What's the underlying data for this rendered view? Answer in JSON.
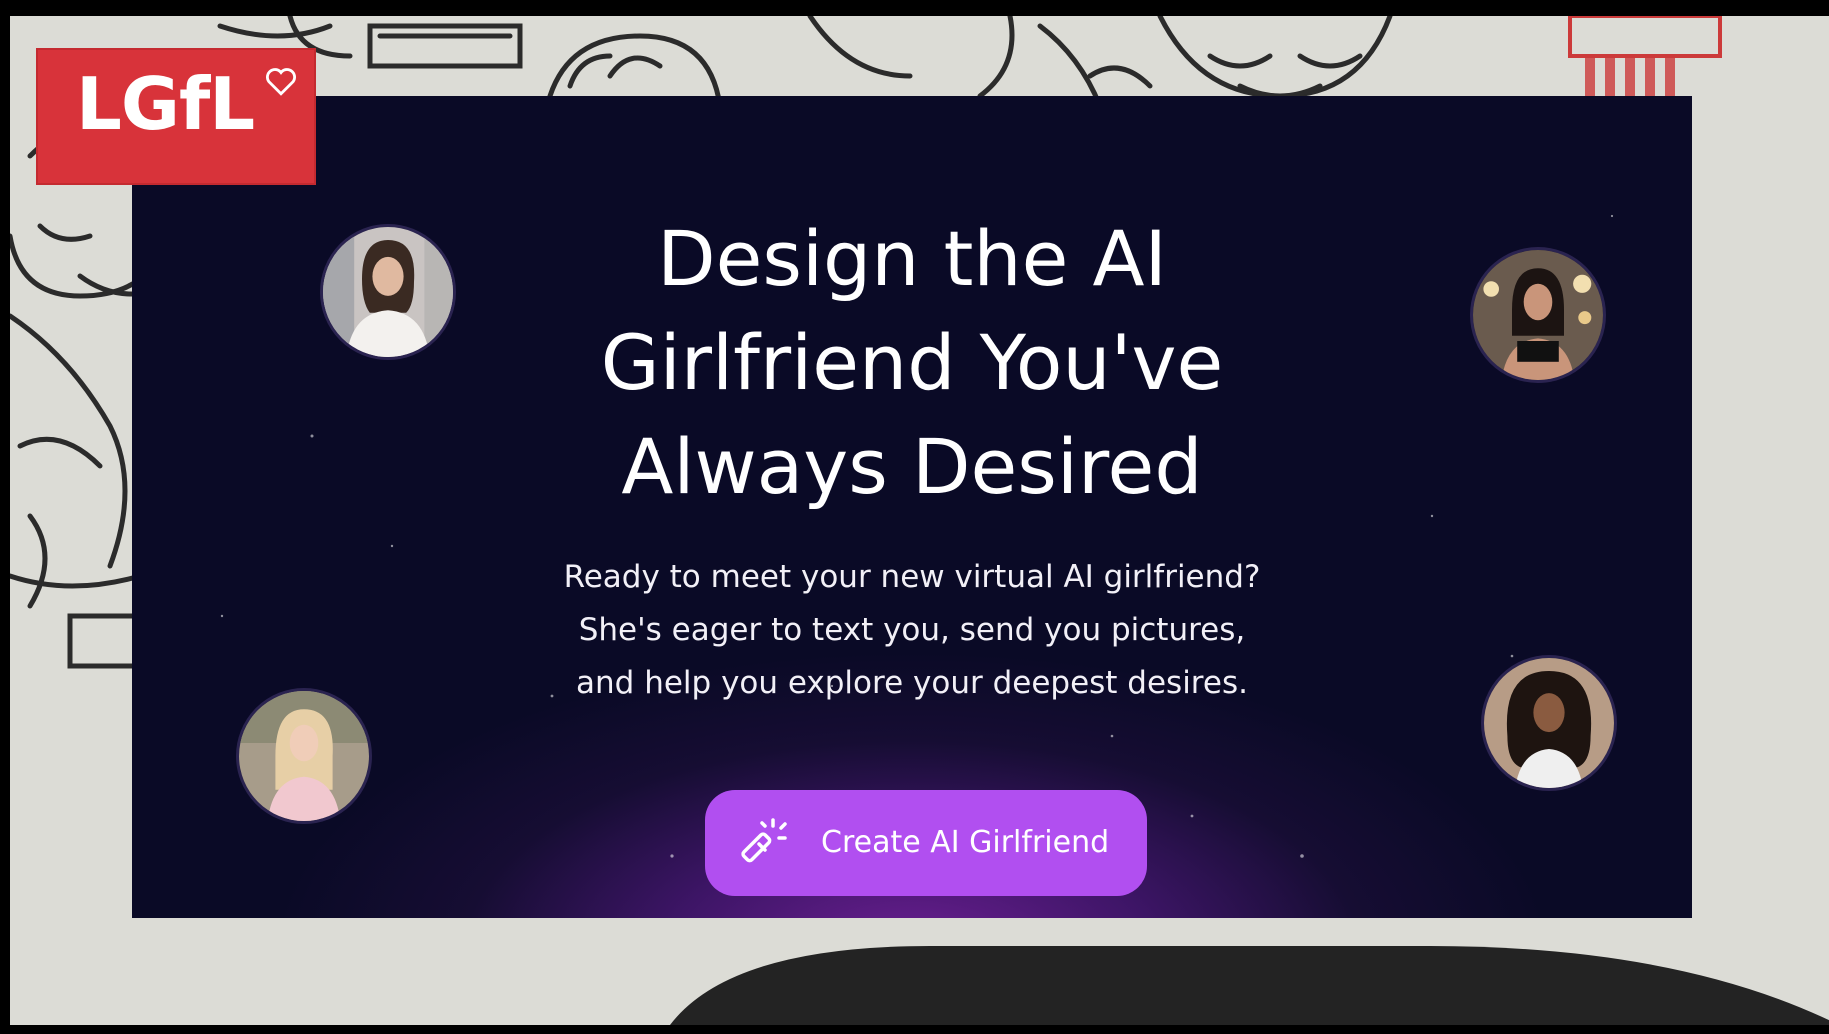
{
  "logo": {
    "text": "LGfL"
  },
  "hero": {
    "title_lines": [
      "Design the AI",
      "Girlfriend You've",
      "Always Desired"
    ],
    "subtitle_lines": [
      "Ready to meet your new virtual AI girlfriend?",
      "She's eager to text you, send you pictures,",
      "and help you explore your deepest desires."
    ],
    "cta_label": "Create AI Girlfriend",
    "cta_icon": "magic-wand-icon"
  },
  "colors": {
    "panel_bg": "#0a0a26",
    "panel_glow": "#6b1f92",
    "cta": "#b14ff0",
    "logo_bg": "#d8333a",
    "wall": "#dcdcd6"
  }
}
